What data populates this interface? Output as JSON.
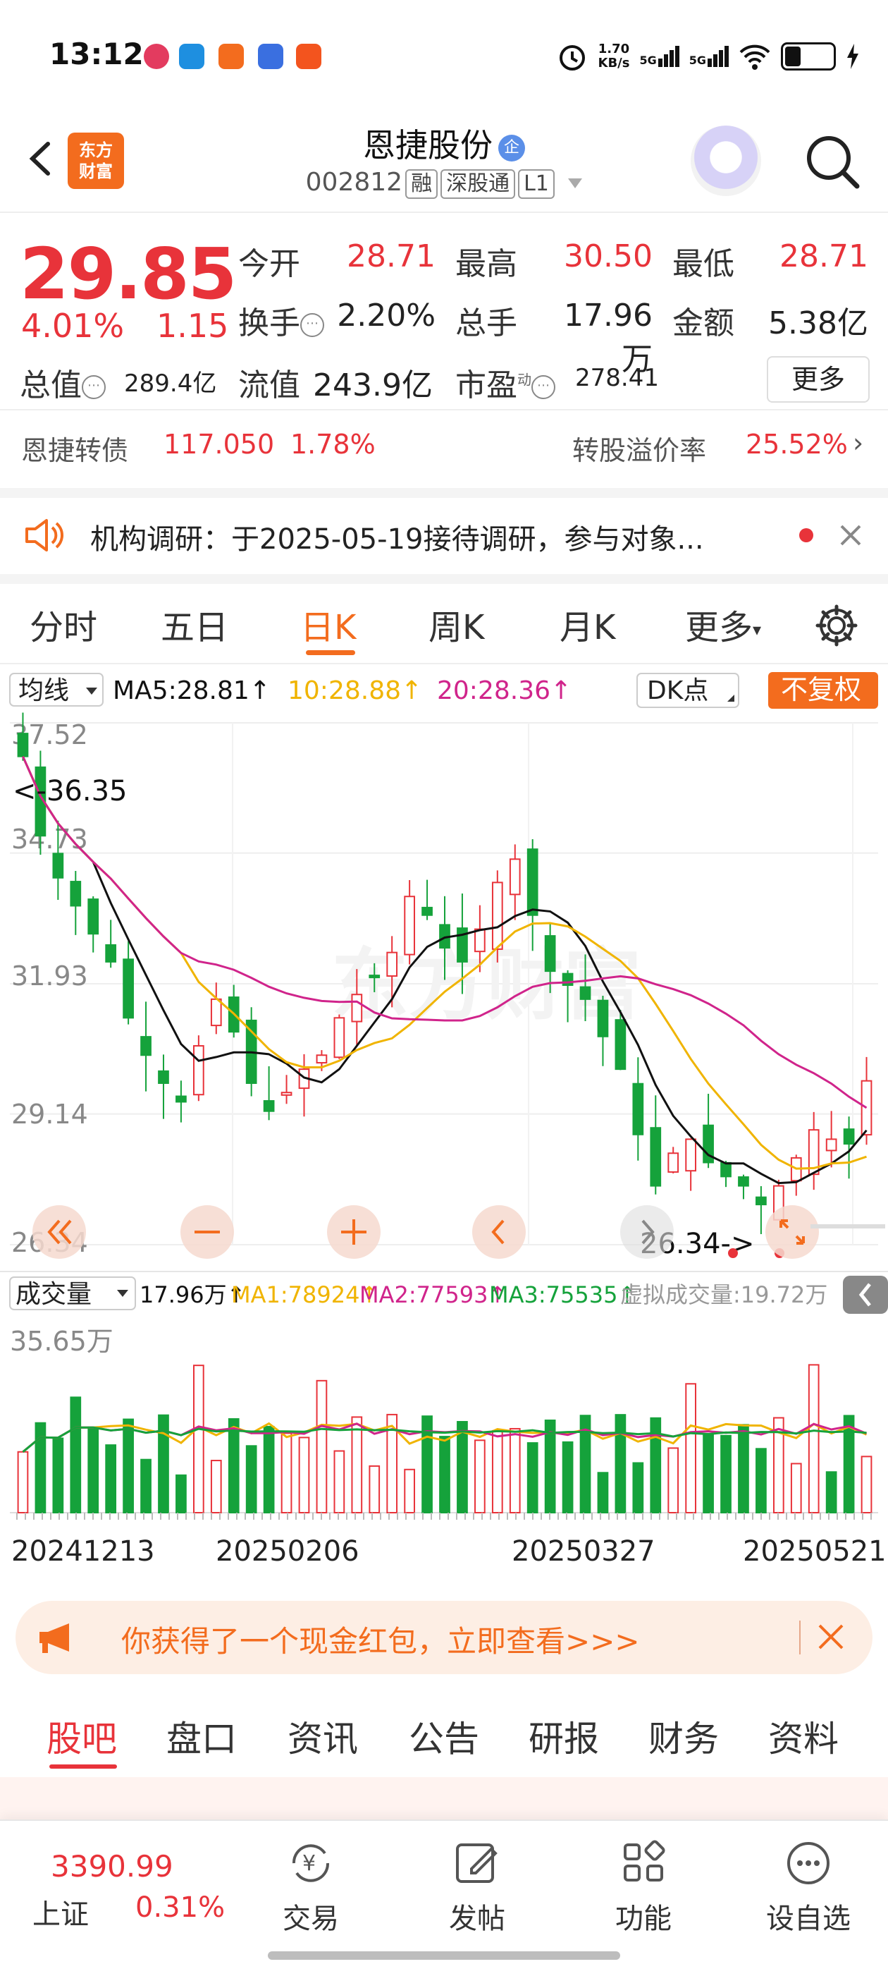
{
  "status_bar": {
    "time": "13:12",
    "net_speed_top": "1.70",
    "net_speed_bottom": "KB/s",
    "sig1": "5G",
    "sig2": "5G"
  },
  "header": {
    "title": "恩捷股份",
    "title_badge": "企",
    "code": "002812",
    "tags": [
      "融",
      "深股通",
      "L1"
    ],
    "logo_line1": "东方",
    "logo_line2": "财富"
  },
  "quote": {
    "price": "29.85",
    "pct": "4.01%",
    "change": "1.15",
    "fields": [
      {
        "label": "今开",
        "value": "28.71",
        "color": "#e8333a"
      },
      {
        "label": "最高",
        "value": "30.50",
        "color": "#e8333a"
      },
      {
        "label": "最低",
        "value": "28.71",
        "color": "#e8333a"
      },
      {
        "label": "换手",
        "value": "2.20%",
        "color": "#222222"
      },
      {
        "label": "总手",
        "value": "17.96万",
        "color": "#222222"
      },
      {
        "label": "金额",
        "value": "5.38亿",
        "color": "#222222"
      },
      {
        "label": "总值",
        "value": "289.4亿",
        "color": "#222222"
      },
      {
        "label": "流值",
        "value": "243.9亿",
        "color": "#222222"
      },
      {
        "label": "市盈",
        "value": "278.41",
        "color": "#222222"
      }
    ],
    "pe_sup": "动",
    "more": "更多"
  },
  "bond": {
    "label": "恩捷转债",
    "price": "117.050",
    "pct": "1.78%",
    "premium_label": "转股溢价率",
    "premium": "25.52%"
  },
  "notice": {
    "text": "机构调研：于2025-05-19接待调研，参与对象..."
  },
  "tabs": [
    "分时",
    "五日",
    "日K",
    "周K",
    "月K",
    "更多"
  ],
  "chart": {
    "ma_selector": "均线",
    "ma5": "MA5:28.81↑",
    "ma10": "10:28.88↑",
    "ma20": "20:28.36↑",
    "dk_button": "DK点",
    "adjust_button": "不复权",
    "price_ticks": [
      "37.52",
      "34.73",
      "31.93",
      "29.14",
      "26.34"
    ],
    "high_marker": "<-36.35",
    "low_marker": "26.34->",
    "volume_selector": "成交量",
    "vol_value": "17.96万↑",
    "vma1": "MA1:78924↑",
    "vma2": "MA2:77593↑",
    "vma3": "MA3:75535↑",
    "virtual_vol": "虚拟成交量:19.72万",
    "vol_max": "35.65万",
    "dates": [
      "20241213",
      "20250206",
      "20250327",
      "20250521"
    ],
    "colors": {
      "up": "#e8333a",
      "down": "#15a23b",
      "ma5": "#111111",
      "ma10": "#f0b400",
      "ma20": "#d0248b"
    }
  },
  "chart_data": {
    "type": "candlestick",
    "ylim": [
      26.34,
      37.52
    ],
    "ma_labels": [
      "MA5",
      "MA10",
      "MA20"
    ],
    "candles_approx": [
      36.8,
      35.1,
      34.2,
      33.6,
      33.0,
      32.4,
      31.2,
      30.4,
      29.8,
      29.4,
      30.6,
      31.6,
      30.9,
      29.8,
      29.2,
      29.6,
      30.1,
      30.4,
      31.2,
      31.7,
      32.1,
      32.6,
      33.8,
      33.4,
      32.7,
      32.4,
      33.1,
      34.1,
      34.6,
      33.4,
      32.2,
      31.9,
      31.6,
      30.8,
      30.1,
      28.7,
      27.6,
      28.3,
      28.6,
      28.1,
      27.8,
      27.6,
      27.2,
      27.6,
      28.2,
      28.8,
      28.6,
      28.5,
      29.85
    ],
    "volume_max": "35.65万"
  },
  "promo": {
    "text": "你获得了一个现金红包，立即查看>>>"
  },
  "bottom_tabs": [
    "股吧",
    "盘口",
    "资讯",
    "公告",
    "研报",
    "财务",
    "资料"
  ],
  "bottom_nav": {
    "index_value": "3390.99",
    "index_name": "上证",
    "index_pct": "0.31%",
    "items": [
      "交易",
      "发帖",
      "功能",
      "设自选"
    ]
  }
}
